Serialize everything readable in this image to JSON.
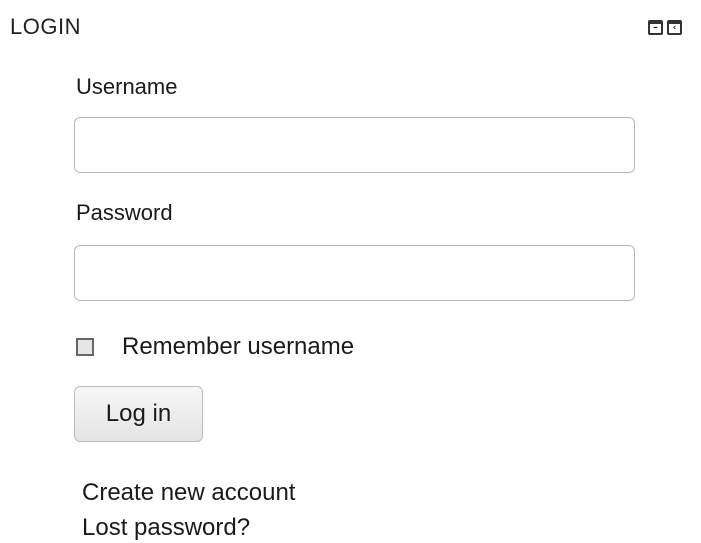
{
  "block": {
    "title": "LOGIN",
    "controls": [
      {
        "name": "minimize",
        "glyph": "–"
      },
      {
        "name": "dock",
        "glyph": "‹"
      }
    ]
  },
  "form": {
    "username_label": "Username",
    "username_value": "",
    "password_label": "Password",
    "password_value": "",
    "remember_label": "Remember username",
    "remember_checked": false,
    "submit_label": "Log in"
  },
  "links": {
    "create_account": "Create new account",
    "lost_password": "Lost password?"
  }
}
